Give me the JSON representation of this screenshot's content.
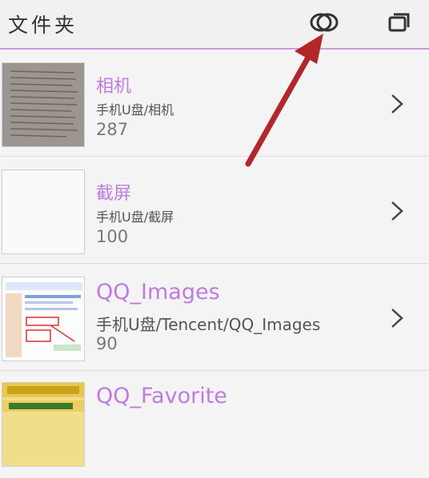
{
  "header": {
    "title": "文件夹",
    "view_icon": "eye-rings-icon",
    "window_icon": "windows-stack-icon"
  },
  "folders": [
    {
      "name": "相机",
      "path": "手机U盘/相机",
      "count": "287"
    },
    {
      "name": "截屏",
      "path": "手机U盘/截屏",
      "count": "100"
    },
    {
      "name": "QQ_Images",
      "path": "手机U盘/Tencent/QQ_Images",
      "count": "90"
    },
    {
      "name": "QQ_Favorite"
    }
  ],
  "colors": {
    "accent": "#c07be0",
    "arrow": "#b3262a"
  }
}
